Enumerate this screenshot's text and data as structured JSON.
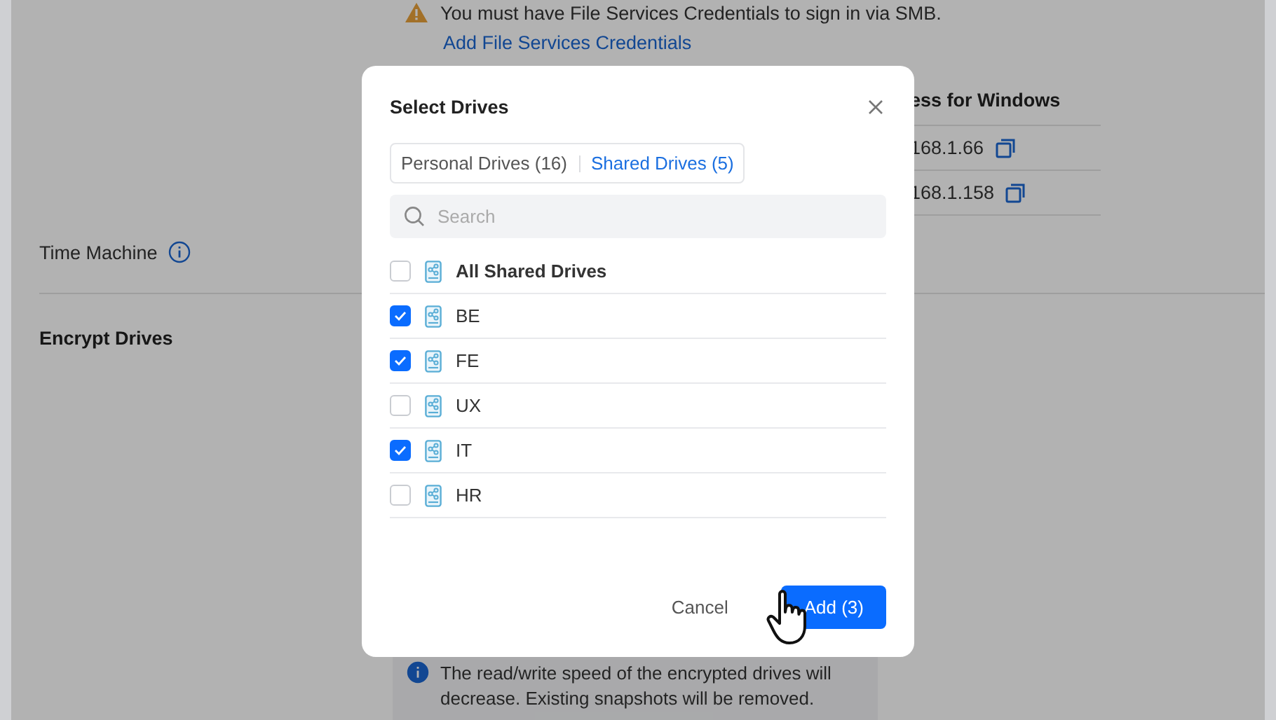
{
  "background": {
    "warning": "You must have File Services Credentials to sign in via SMB.",
    "credentials_link": "Add File Services Credentials",
    "table": {
      "column_header": "ess for Windows",
      "rows": [
        {
          "address": "168.1.66"
        },
        {
          "address": "168.1.158"
        }
      ]
    },
    "time_machine_label": "Time Machine",
    "encrypt_drives_label": "Encrypt Drives",
    "encrypt_note": "The read/write speed of the encrypted drives will decrease. Existing snapshots will be removed."
  },
  "dialog": {
    "title": "Select Drives",
    "tabs": [
      {
        "label": "Personal Drives (16)",
        "selected": false
      },
      {
        "label": "Shared Drives (5)",
        "selected": true
      }
    ],
    "search": {
      "placeholder": "Search"
    },
    "drives": [
      {
        "name": "All Shared Drives",
        "kind": "all",
        "checked": false
      },
      {
        "name": "BE",
        "kind": "drive",
        "checked": true
      },
      {
        "name": "FE",
        "kind": "drive",
        "checked": true
      },
      {
        "name": "UX",
        "kind": "drive",
        "checked": false
      },
      {
        "name": "IT",
        "kind": "drive",
        "checked": true
      },
      {
        "name": "HR",
        "kind": "drive",
        "checked": false
      }
    ],
    "buttons": [
      {
        "label": "Cancel",
        "kind": "secondary"
      },
      {
        "label": "Add (3)",
        "kind": "primary"
      }
    ]
  }
}
